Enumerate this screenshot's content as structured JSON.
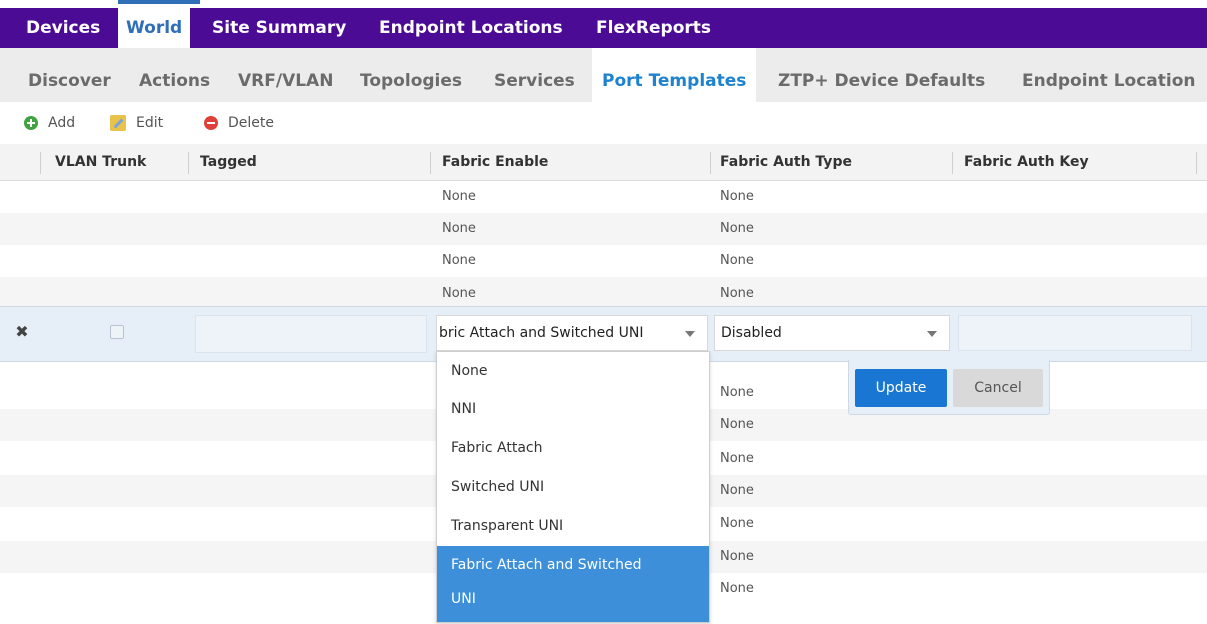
{
  "top_nav": {
    "tabs": [
      {
        "label": "Devices"
      },
      {
        "label": "World",
        "active": true
      },
      {
        "label": "Site Summary"
      },
      {
        "label": "Endpoint Locations"
      },
      {
        "label": "FlexReports"
      }
    ]
  },
  "sub_nav": {
    "tabs": [
      {
        "label": "Discover"
      },
      {
        "label": "Actions"
      },
      {
        "label": "VRF/VLAN"
      },
      {
        "label": "Topologies"
      },
      {
        "label": "Services"
      },
      {
        "label": "Port Templates",
        "active": true
      },
      {
        "label": "ZTP+ Device Defaults"
      },
      {
        "label": "Endpoint Location"
      }
    ]
  },
  "toolbar": {
    "add_label": "Add",
    "edit_label": "Edit",
    "delete_label": "Delete"
  },
  "grid": {
    "columns": [
      "VLAN Trunk",
      "Tagged",
      "Fabric Enable",
      "Fabric Auth Type",
      "Fabric Auth Key"
    ],
    "rows_above": [
      {
        "fabric_enable": "None",
        "fabric_auth_type": "None"
      },
      {
        "fabric_enable": "None",
        "fabric_auth_type": "None"
      },
      {
        "fabric_enable": "None",
        "fabric_auth_type": "None"
      },
      {
        "fabric_enable": "None",
        "fabric_auth_type": "None"
      }
    ],
    "rows_below_auth_type": [
      "None",
      "None",
      "None",
      "None",
      "None",
      "None",
      "None"
    ]
  },
  "edit_row": {
    "close_glyph": "✖",
    "vlan_trunk_checked": false,
    "fabric_enable_value": "bric Attach and Switched UNI",
    "fabric_auth_type_value": "Disabled",
    "update_label": "Update",
    "cancel_label": "Cancel"
  },
  "dropdown": {
    "options": [
      "None",
      "NNI",
      "Fabric Attach",
      "Switched UNI",
      "Transparent UNI"
    ],
    "selected_line1": "Fabric Attach and Switched",
    "selected_line2": "UNI"
  },
  "colors": {
    "top_nav_bg": "#4b0b94",
    "accent_blue": "#1e82cf",
    "selected_option": "#3d8fda",
    "update_button": "#1976d2"
  },
  "icons": [
    "add-icon",
    "edit-icon",
    "delete-icon",
    "close-icon",
    "caret-down-icon"
  ]
}
